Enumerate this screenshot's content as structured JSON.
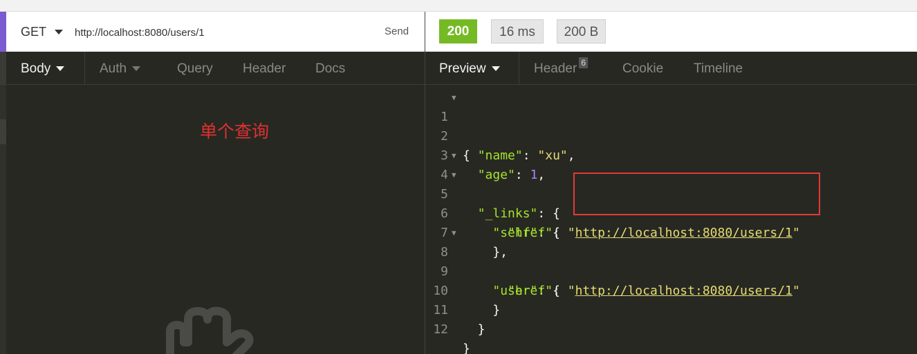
{
  "request": {
    "method": "GET",
    "url": "http://localhost:8080/users/1",
    "send_label": "Send"
  },
  "response_status": {
    "status_code": "200",
    "time": "16 ms",
    "size": "200 B",
    "status_color": "#75ba24"
  },
  "request_tabs": [
    "Body",
    "Auth",
    "Query",
    "Header",
    "Docs"
  ],
  "response_tabs": {
    "preview": "Preview",
    "header": "Header",
    "header_count": "6",
    "cookie": "Cookie",
    "timeline": "Timeline"
  },
  "annotation": "单个查询",
  "response_json": {
    "line_numbers": [
      "1",
      "2",
      "3",
      "4",
      "5",
      "6",
      "7",
      "8",
      "9",
      "10",
      "11",
      "12"
    ],
    "open_brace": "{",
    "name_key": "\"name\"",
    "name_value": "\"xu\"",
    "age_key": "\"age\"",
    "age_value": "1",
    "links_key": "\"_links\"",
    "self_key": "\"self\"",
    "href_key": "\"href\"",
    "self_href": "http://localhost:8080/users/1",
    "user_key": "\"user\"",
    "user_href": "http://localhost:8080/users/1"
  },
  "colors": {
    "method_accent": "#7b5bd1",
    "annotation_red": "#e03131",
    "highlight_box": "#e53935",
    "key_green": "#a6e22e",
    "string_yellow": "#e6db74",
    "number_purple": "#ae81ff"
  },
  "icons": [
    "chevron-down-icon",
    "fold-arrow-icon",
    "hand-icon"
  ]
}
